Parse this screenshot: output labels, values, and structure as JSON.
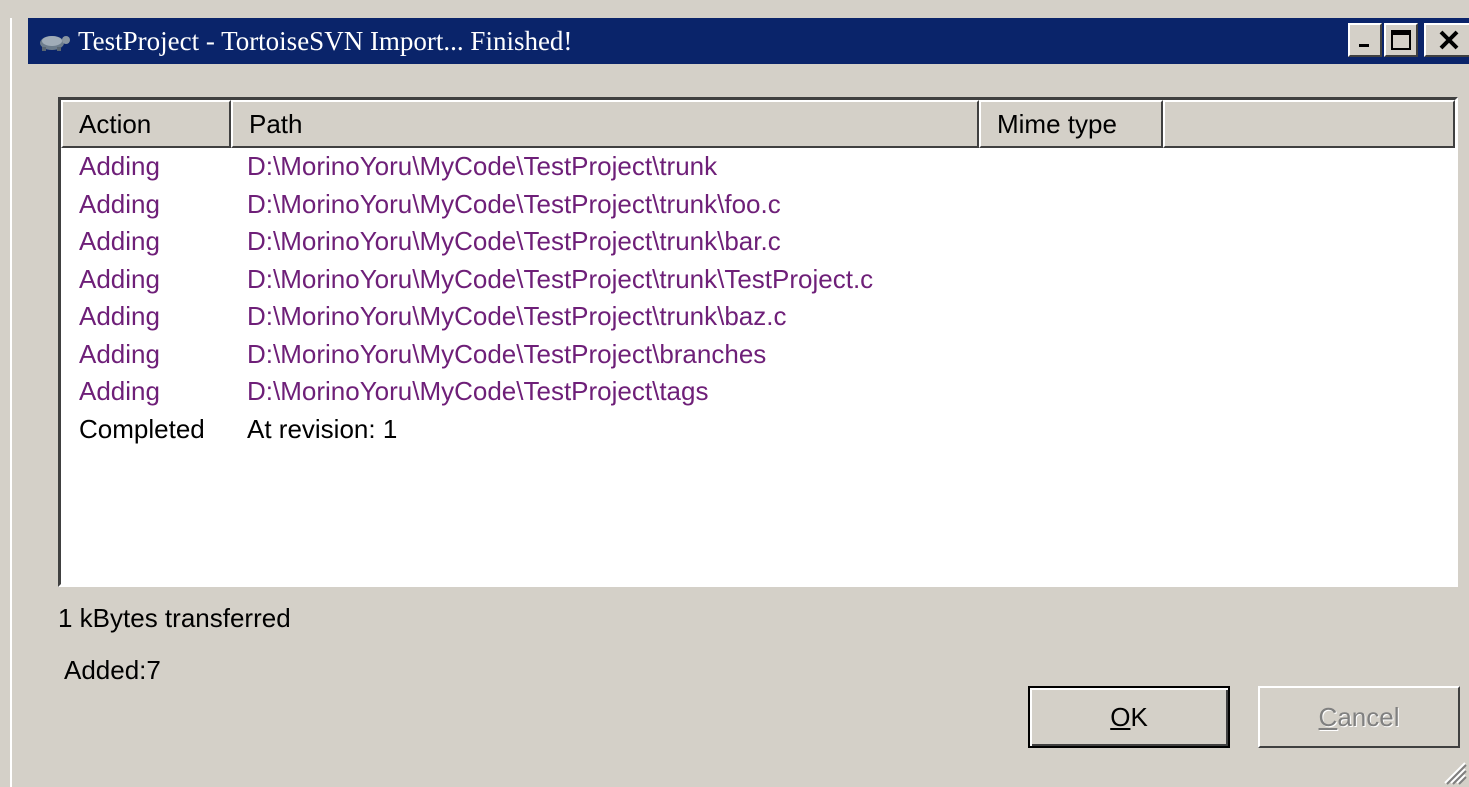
{
  "window": {
    "title": "TestProject - TortoiseSVN Import... Finished!",
    "app_icon": "tortoise-icon"
  },
  "columns": {
    "action": "Action",
    "path": "Path",
    "mime": "Mime type"
  },
  "rows": [
    {
      "action": "Adding",
      "path": "D:\\MorinoYoru\\MyCode\\TestProject\\trunk",
      "status": "added"
    },
    {
      "action": "Adding",
      "path": "D:\\MorinoYoru\\MyCode\\TestProject\\trunk\\foo.c",
      "status": "added"
    },
    {
      "action": "Adding",
      "path": "D:\\MorinoYoru\\MyCode\\TestProject\\trunk\\bar.c",
      "status": "added"
    },
    {
      "action": "Adding",
      "path": "D:\\MorinoYoru\\MyCode\\TestProject\\trunk\\TestProject.c",
      "status": "added"
    },
    {
      "action": "Adding",
      "path": "D:\\MorinoYoru\\MyCode\\TestProject\\trunk\\baz.c",
      "status": "added"
    },
    {
      "action": "Adding",
      "path": "D:\\MorinoYoru\\MyCode\\TestProject\\branches",
      "status": "added"
    },
    {
      "action": "Adding",
      "path": "D:\\MorinoYoru\\MyCode\\TestProject\\tags",
      "status": "added"
    },
    {
      "action": "Completed",
      "path": "At revision: 1",
      "status": "done"
    }
  ],
  "status": {
    "bytes": "1 kBytes transferred",
    "added": "Added:7"
  },
  "buttons": {
    "ok_mnemonic": "O",
    "ok_rest": "K",
    "cancel_mnemonic": "C",
    "cancel_rest": "ancel"
  },
  "colors": {
    "titlebar": "#0a246a",
    "added_text": "#6e1f78",
    "face": "#d4d0c8"
  }
}
